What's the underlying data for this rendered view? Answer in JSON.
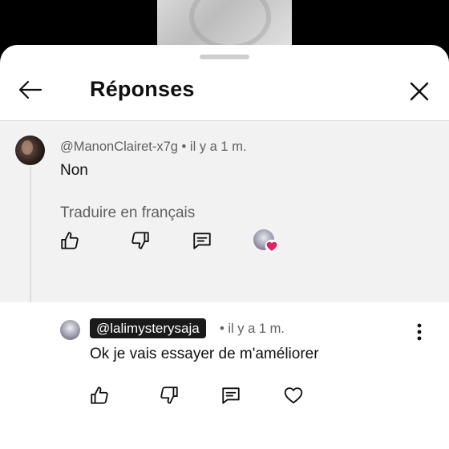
{
  "header": {
    "title": "Réponses",
    "back_icon": "arrow-left-icon",
    "close_icon": "close-icon"
  },
  "parent_comment": {
    "meta": "@ManonClairet-x7g • il y a 1 m.",
    "text": "Non",
    "translate_label": "Traduire en français",
    "actions": [
      "thumbs-up-icon",
      "thumbs-down-icon",
      "reply-icon",
      "creator-heart-icon"
    ]
  },
  "reply_comment": {
    "handle": "@lalimysterysaja",
    "meta": "• il y a 1 m.",
    "text": "Ok je vais essayer de m'améliorer",
    "actions": [
      "thumbs-up-icon",
      "thumbs-down-icon",
      "reply-icon",
      "heart-icon"
    ],
    "more_icon": "more-vertical-icon"
  },
  "colors": {
    "sheet_bg": "#ffffff",
    "highlight_bg": "#f2f2f2",
    "primary_text": "#0f0f0f",
    "secondary_text": "#606060",
    "heart_badge": "#e0245e"
  }
}
